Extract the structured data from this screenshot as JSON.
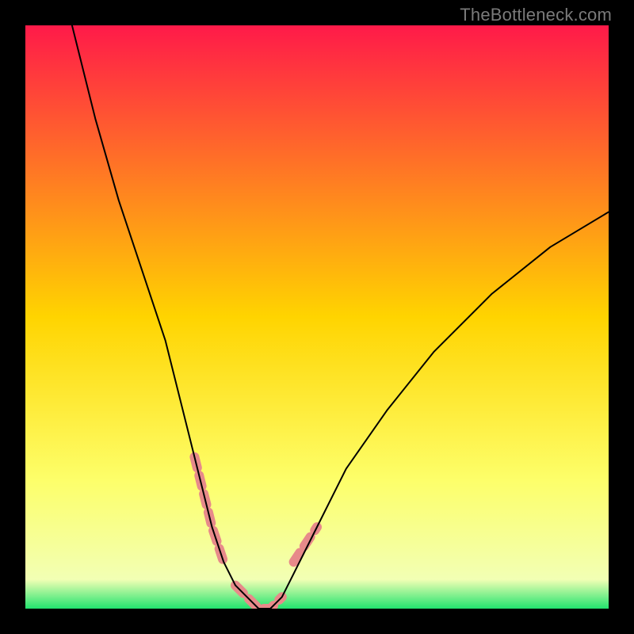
{
  "watermark": "TheBottleneck.com",
  "chart_data": {
    "type": "line",
    "title": "",
    "xlabel": "",
    "ylabel": "",
    "xlim": [
      0,
      100
    ],
    "ylim": [
      0,
      100
    ],
    "grid": false,
    "legend": false,
    "gradient_stops": [
      {
        "offset": 0.0,
        "color": "#ff1a49"
      },
      {
        "offset": 0.5,
        "color": "#ffd400"
      },
      {
        "offset": 0.78,
        "color": "#fdff6a"
      },
      {
        "offset": 0.95,
        "color": "#f2ffb4"
      },
      {
        "offset": 1.0,
        "color": "#22e36e"
      }
    ],
    "series": [
      {
        "name": "bottleneck-curve",
        "color": "#000000",
        "stroke_width": 2,
        "x": [
          8,
          12,
          16,
          20,
          24,
          28,
          30,
          32,
          34,
          36,
          38,
          40,
          42,
          44,
          46,
          50,
          55,
          62,
          70,
          80,
          90,
          100
        ],
        "y": [
          100,
          84,
          70,
          58,
          46,
          30,
          22,
          14,
          8,
          4,
          2,
          0,
          0,
          2,
          6,
          14,
          24,
          34,
          44,
          54,
          62,
          68
        ]
      }
    ],
    "highlight_segments": [
      {
        "name": "left-descent-highlight",
        "color": "#e78a8a",
        "stroke_width": 12,
        "x": [
          29,
          30,
          31,
          32,
          33,
          34
        ],
        "y": [
          26,
          22,
          18,
          14,
          11,
          8
        ]
      },
      {
        "name": "trough-highlight",
        "color": "#e78a8a",
        "stroke_width": 12,
        "x": [
          36,
          38,
          40,
          42,
          44
        ],
        "y": [
          4,
          2,
          0,
          0,
          2
        ]
      },
      {
        "name": "right-ascent-highlight",
        "color": "#e78a8a",
        "stroke_width": 12,
        "x": [
          46,
          48,
          50
        ],
        "y": [
          8,
          11,
          14
        ]
      }
    ]
  }
}
